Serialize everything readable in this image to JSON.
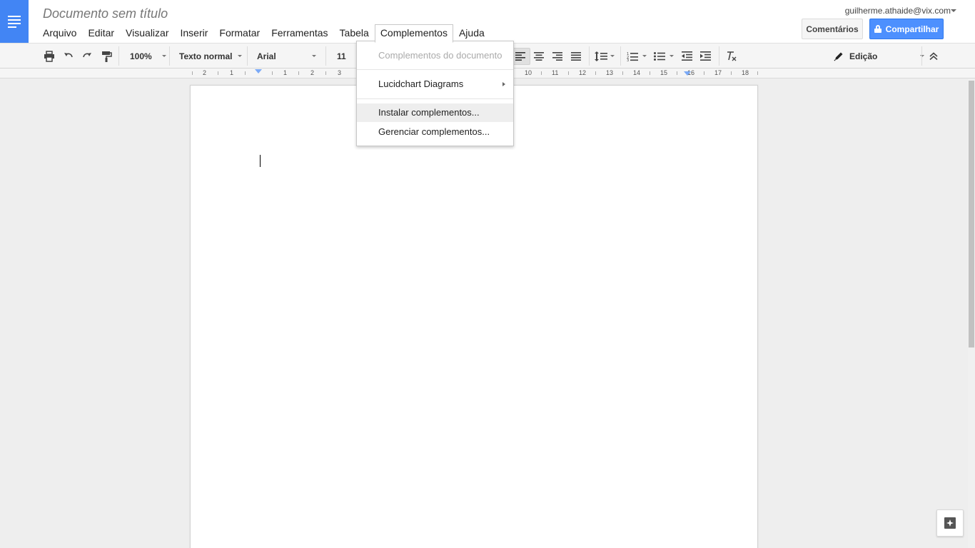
{
  "app": {
    "doc_title": "Documento sem título",
    "account_email": "guilherme.athaide@vix.com"
  },
  "menu": {
    "items": [
      "Arquivo",
      "Editar",
      "Visualizar",
      "Inserir",
      "Formatar",
      "Ferramentas",
      "Tabela",
      "Complementos",
      "Ajuda"
    ]
  },
  "buttons": {
    "comments": "Comentários",
    "share": "Compartilhar"
  },
  "toolbar": {
    "zoom": "100%",
    "style": "Texto normal",
    "font": "Arial",
    "font_size": "11",
    "mode": "Edição"
  },
  "ruler": {
    "left_numbers": [
      "2",
      "1"
    ],
    "right_numbers": [
      "1",
      "2",
      "3",
      "10",
      "11",
      "12",
      "13",
      "14",
      "15",
      "16",
      "17",
      "18"
    ]
  },
  "dropdown": {
    "header": "Complementos do documento",
    "lucidchart": "Lucidchart Diagrams",
    "install": "Instalar complementos...",
    "manage": "Gerenciar complementos..."
  },
  "colors": {
    "brand": "#4285f4",
    "share_button": "#4d90fe"
  }
}
